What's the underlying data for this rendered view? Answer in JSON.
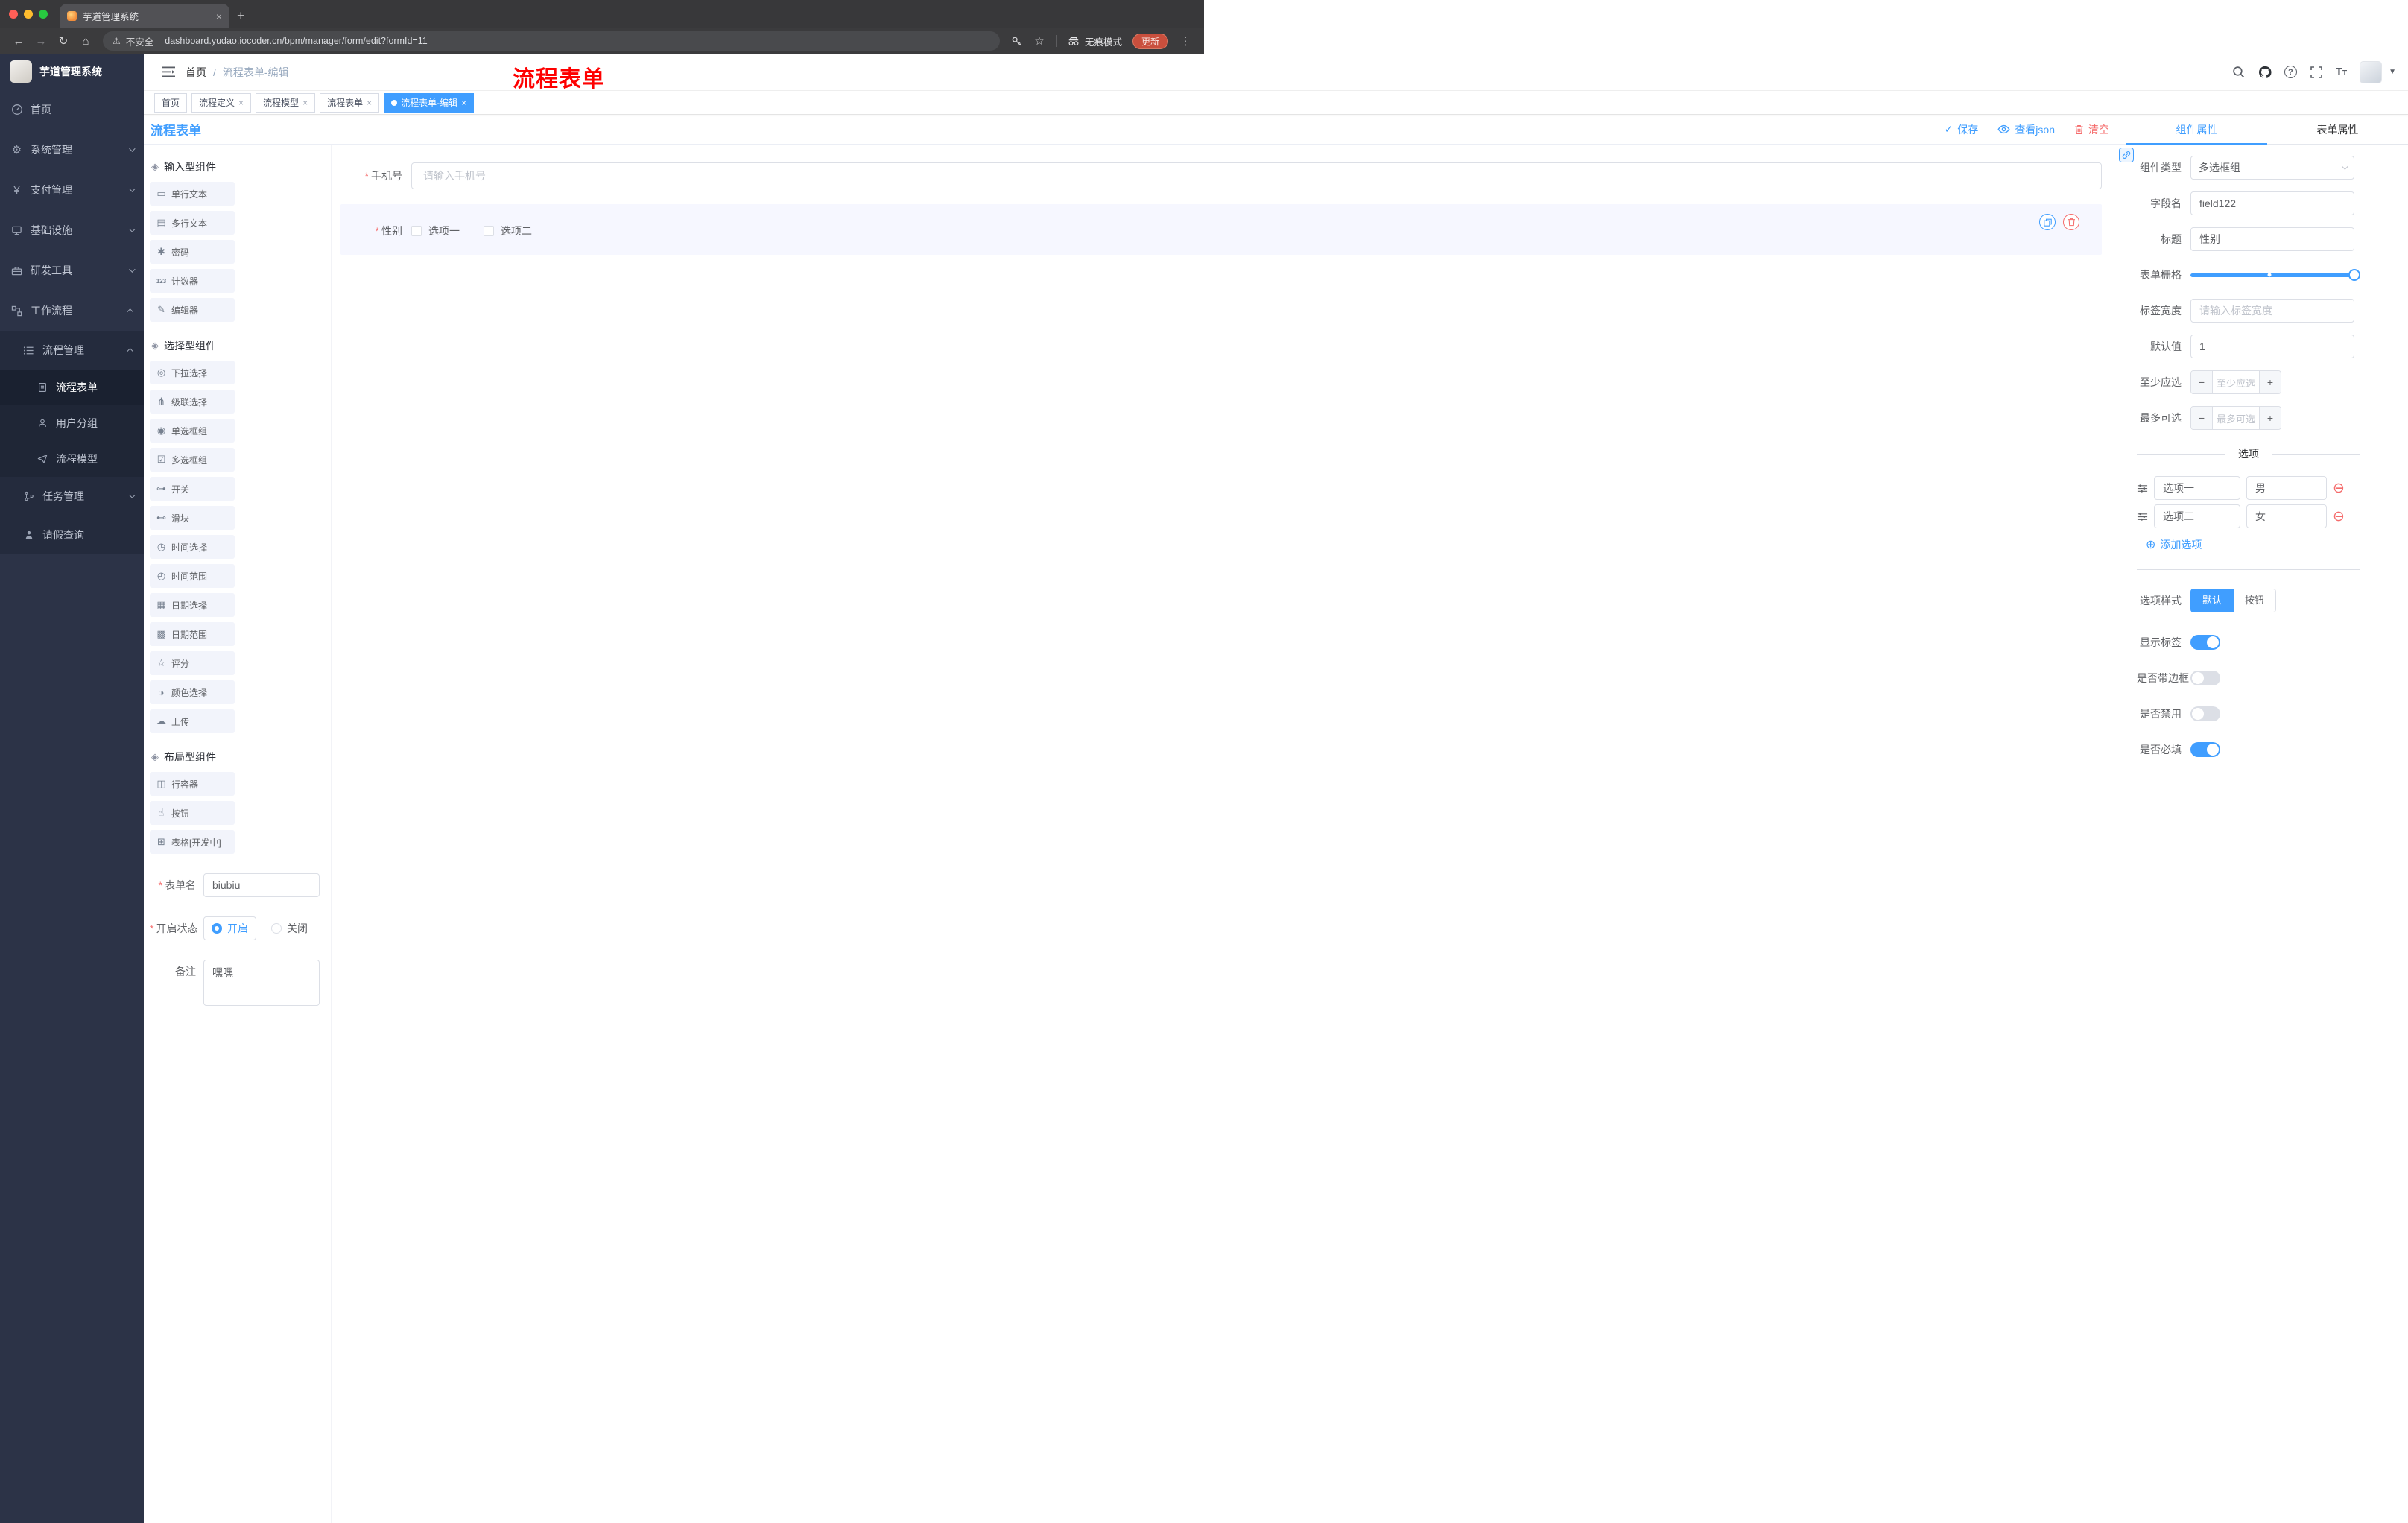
{
  "browser": {
    "tab_title": "芋道管理系统",
    "security_label": "不安全",
    "url": "dashboard.yudao.iocoder.cn/bpm/manager/form/edit?formId=11",
    "incognito_label": "无痕模式",
    "update_label": "更新"
  },
  "sidebar": {
    "logo_title": "芋道管理系统",
    "menu": [
      {
        "label": "首页",
        "icon": "dashboard-icon"
      },
      {
        "label": "系统管理",
        "icon": "gear-icon"
      },
      {
        "label": "支付管理",
        "icon": "yen-icon"
      },
      {
        "label": "基础设施",
        "icon": "monitor-icon"
      },
      {
        "label": "研发工具",
        "icon": "toolbox-icon"
      },
      {
        "label": "工作流程",
        "icon": "workflow-icon"
      }
    ],
    "submenu": [
      {
        "label": "流程管理",
        "icon": "list-icon"
      },
      {
        "label": "流程表单",
        "icon": "form-doc-icon"
      },
      {
        "label": "用户分组",
        "icon": "users-icon"
      },
      {
        "label": "流程模型",
        "icon": "paper-plane-icon"
      },
      {
        "label": "任务管理",
        "icon": "branch-icon"
      },
      {
        "label": "请假查询",
        "icon": "person-icon"
      }
    ]
  },
  "navbar": {
    "breadcrumb": [
      "首页",
      "流程表单-编辑"
    ],
    "annotation": "流程表单"
  },
  "tags": [
    {
      "label": "首页"
    },
    {
      "label": "流程定义"
    },
    {
      "label": "流程模型"
    },
    {
      "label": "流程表单"
    },
    {
      "label": "流程表单-编辑"
    }
  ],
  "editor": {
    "board_title": "流程表单",
    "toolbar": {
      "save": "保存",
      "view_json": "查看json",
      "clear": "清空"
    },
    "palette": {
      "groups": [
        {
          "title": "输入型组件",
          "items": [
            {
              "label": "单行文本",
              "icon": "input-field-icon"
            },
            {
              "label": "多行文本",
              "icon": "textarea-icon"
            },
            {
              "label": "密码",
              "icon": "password-icon"
            },
            {
              "label": "计数器",
              "icon": "counter-icon"
            },
            {
              "label": "编辑器",
              "icon": "rich-editor-icon"
            }
          ]
        },
        {
          "title": "选择型组件",
          "items": [
            {
              "label": "下拉选择",
              "icon": "select-icon"
            },
            {
              "label": "级联选择",
              "icon": "cascader-icon"
            },
            {
              "label": "单选框组",
              "icon": "radio-group-icon"
            },
            {
              "label": "多选框组",
              "icon": "checkbox-group-icon"
            },
            {
              "label": "开关",
              "icon": "switch-icon"
            },
            {
              "label": "滑块",
              "icon": "slider-icon"
            },
            {
              "label": "时间选择",
              "icon": "time-picker-icon"
            },
            {
              "label": "时间范围",
              "icon": "time-range-icon"
            },
            {
              "label": "日期选择",
              "icon": "date-picker-icon"
            },
            {
              "label": "日期范围",
              "icon": "date-range-icon"
            },
            {
              "label": "评分",
              "icon": "rate-icon"
            },
            {
              "label": "颜色选择",
              "icon": "color-picker-icon"
            },
            {
              "label": "上传",
              "icon": "upload-icon"
            }
          ]
        },
        {
          "title": "布局型组件",
          "items": [
            {
              "label": "行容器",
              "icon": "row-container-icon"
            },
            {
              "label": "按钮",
              "icon": "button-icon"
            },
            {
              "label": "表格[开发中]",
              "icon": "table-icon"
            }
          ]
        }
      ],
      "form": {
        "name_label": "表单名",
        "name_value": "biubiu",
        "status_label": "开启状态",
        "status_on": "开启",
        "status_off": "关闭",
        "remark_label": "备注",
        "remark_value": "嘿嘿"
      }
    },
    "canvas": {
      "phone": {
        "label": "手机号",
        "placeholder": "请输入手机号"
      },
      "gender": {
        "label": "性别",
        "option1": "选项一",
        "option2": "选项二"
      }
    },
    "props": {
      "tabs": [
        "组件属性",
        "表单属性"
      ],
      "type_label": "组件类型",
      "type_value": "多选框组",
      "field_label": "字段名",
      "field_value": "field122",
      "title_label": "标题",
      "title_value": "性别",
      "grid_label": "表单栅格",
      "label_width_label": "标签宽度",
      "label_width_placeholder": "请输入标签宽度",
      "default_label": "默认值",
      "default_value": "1",
      "min_label": "至少应选",
      "min_placeholder": "至少应选",
      "max_label": "最多可选",
      "max_placeholder": "最多可选",
      "options_divider": "选项",
      "option_rows": [
        {
          "label": "选项一",
          "value": "男"
        },
        {
          "label": "选项二",
          "value": "女"
        }
      ],
      "add_option": "添加选项",
      "style_label": "选项样式",
      "style_default": "默认",
      "style_button": "按钮",
      "switches": [
        {
          "label": "显示标签",
          "on": true
        },
        {
          "label": "是否带边框",
          "on": false
        },
        {
          "label": "是否禁用",
          "on": false
        },
        {
          "label": "是否必填",
          "on": true
        }
      ]
    }
  },
  "colors": {
    "primary": "#409eff",
    "danger": "#f56c6c",
    "annotation": "#fe0000"
  }
}
